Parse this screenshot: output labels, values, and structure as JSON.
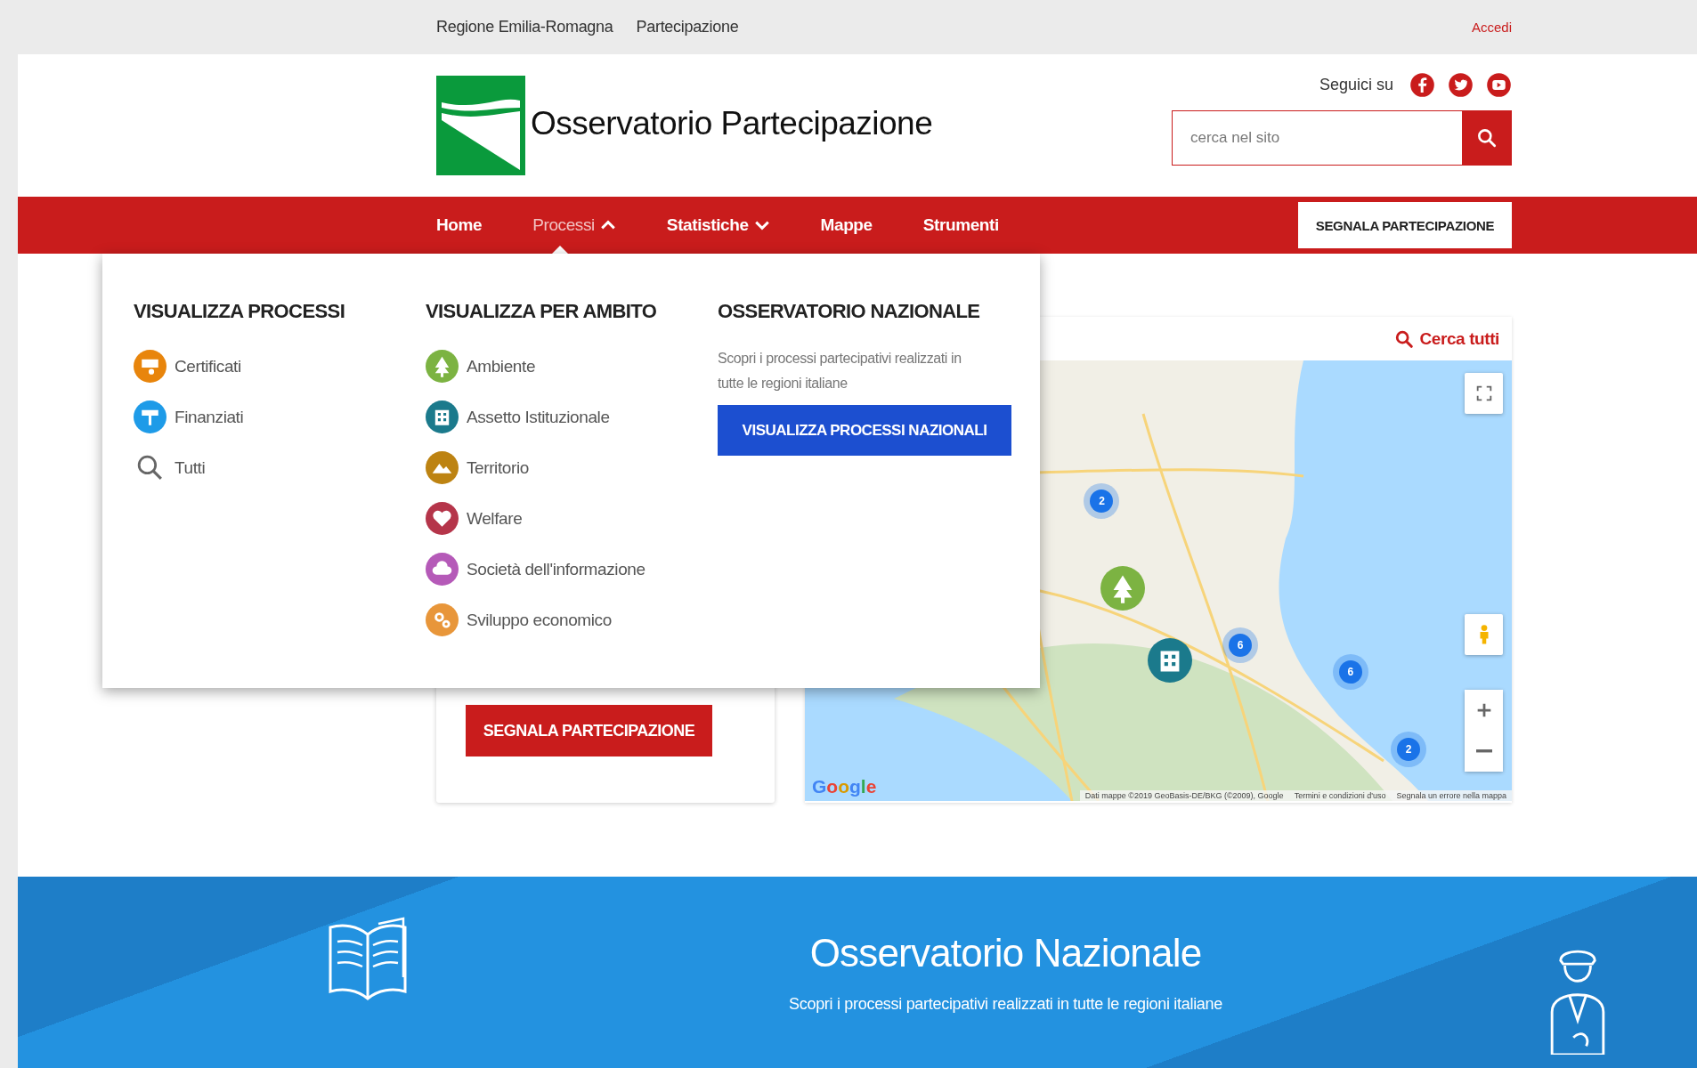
{
  "top_bar": {
    "links": [
      "Regione Emilia-Romagna",
      "Partecipazione"
    ],
    "login": "Accedi"
  },
  "header": {
    "site_title": "Osservatorio Partecipazione",
    "follow_label": "Seguici su",
    "social": [
      {
        "kind": "facebook"
      },
      {
        "kind": "twitter"
      },
      {
        "kind": "youtube"
      }
    ],
    "search": {
      "placeholder": "cerca nel sito"
    }
  },
  "nav": {
    "items": [
      {
        "label": "Home",
        "kind": "link",
        "selected": false
      },
      {
        "label": "Processi",
        "kind": "dropdown",
        "selected": true,
        "expanded": true
      },
      {
        "label": "Statistiche",
        "kind": "dropdown",
        "selected": false,
        "expanded": false
      },
      {
        "label": "Mappe",
        "kind": "link",
        "selected": false
      },
      {
        "label": "Strumenti",
        "kind": "link",
        "selected": false
      }
    ],
    "report_button": "SEGNALA PARTECIPAZIONE"
  },
  "dropdown": {
    "columns": [
      {
        "heading": "VISUALIZZA PROCESSI",
        "kind": "list",
        "items": [
          {
            "label": "Certificati",
            "kind": "certificate",
            "color": "#e8850c"
          },
          {
            "label": "Finanziati",
            "kind": "funded",
            "color": "#1e9be8"
          },
          {
            "label": "Tutti",
            "kind": "search"
          }
        ]
      },
      {
        "heading": "VISUALIZZA PER AMBITO",
        "kind": "list",
        "items": [
          {
            "label": "Ambiente",
            "kind": "tree",
            "color": "#7cb342"
          },
          {
            "label": "Assetto Istituzionale",
            "kind": "building",
            "color": "#1b7a8c"
          },
          {
            "label": "Territorio",
            "kind": "mountain",
            "color": "#bd8312"
          },
          {
            "label": "Welfare",
            "kind": "heart",
            "color": "#b5354a"
          },
          {
            "label": "Società dell'informazione",
            "kind": "cloud",
            "color": "#b55ab8"
          },
          {
            "label": "Sviluppo economico",
            "kind": "gears",
            "color": "#e8963a"
          }
        ]
      },
      {
        "heading": "OSSERVATORIO NAZIONALE",
        "kind": "promo",
        "text": "Scopri i processi partecipativi realizzati in tutte le regioni italiane",
        "button": "VISUALIZZA PROCESSI NAZIONALI"
      }
    ]
  },
  "report_card": {
    "button": "SEGNALA PARTECIPAZIONE"
  },
  "map_card": {
    "search_all": "Cerca tutti",
    "markers": [
      {
        "kind": "cluster",
        "count": "2"
      },
      {
        "kind": "cluster",
        "count": "6"
      },
      {
        "kind": "cluster",
        "count": "6"
      },
      {
        "kind": "cluster",
        "count": "2"
      },
      {
        "kind": "tree",
        "color": "#7cb342"
      },
      {
        "kind": "building",
        "color": "#1b7a8c"
      }
    ],
    "logo": "Google",
    "attribution": [
      "Dati mappe ©2019 GeoBasis-DE/BKG (©2009), Google",
      "Termini e condizioni d'uso",
      "Segnala un errore nella mappa"
    ]
  },
  "footer": {
    "title": "Osservatorio Nazionale",
    "subtitle": "Scopri i processi partecipativi realizzati in tutte le regioni italiane"
  }
}
